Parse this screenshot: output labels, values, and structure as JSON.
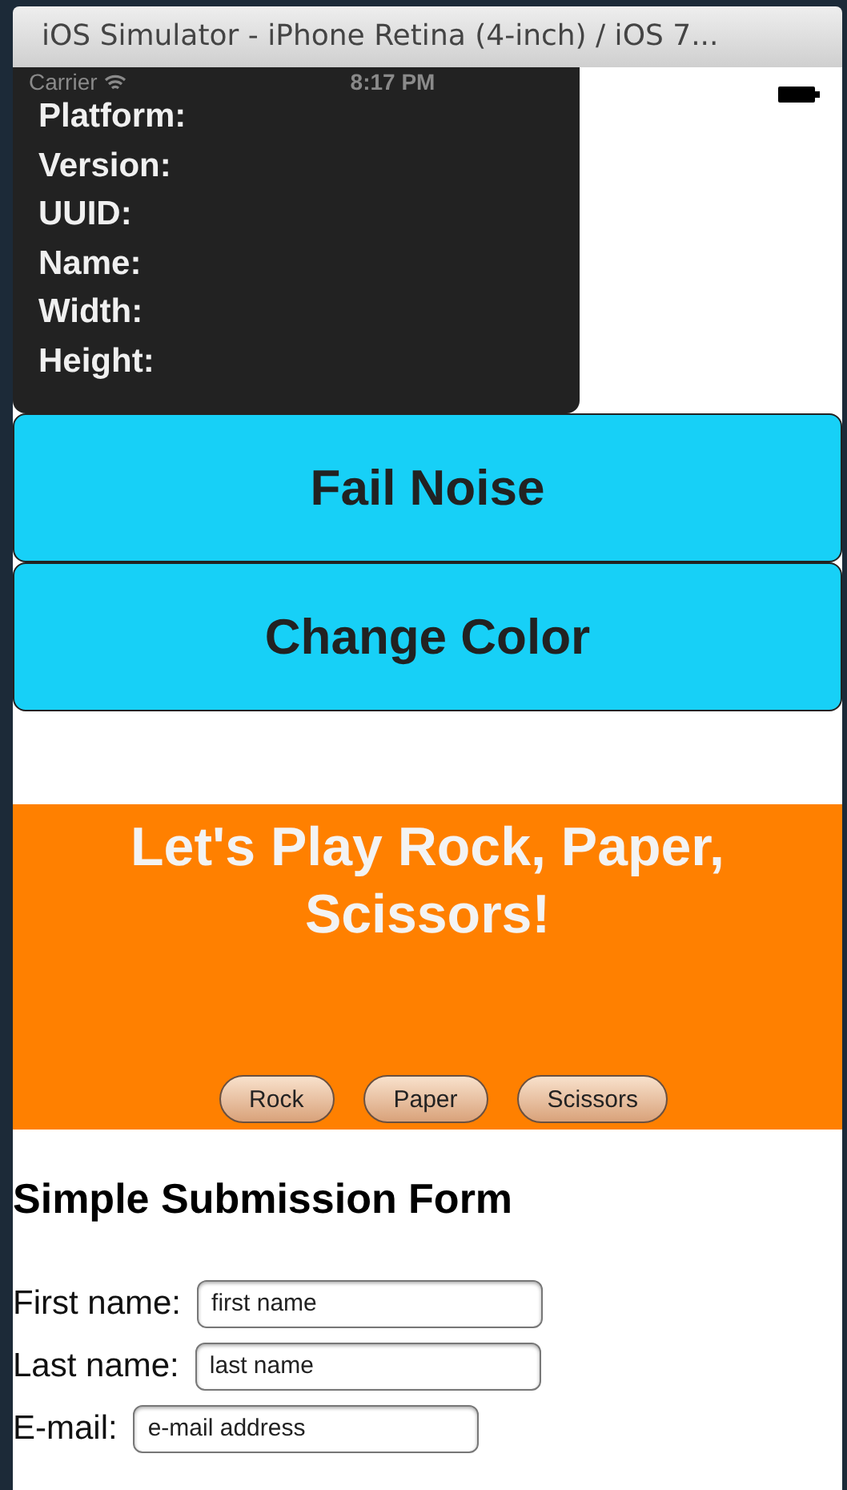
{
  "window": {
    "title": "iOS Simulator - iPhone Retina (4-inch) / iOS 7..."
  },
  "status_bar": {
    "carrier": "Carrier",
    "time": "8:17 PM"
  },
  "device_info": {
    "labels": [
      "Platform:",
      "Version:",
      "UUID:",
      "Name:",
      "Width:",
      "Height:"
    ]
  },
  "buttons": [
    "Fail Noise",
    "Change Color"
  ],
  "game": {
    "title": "Let's Play Rock, Paper, Scissors!",
    "choices": [
      "Rock",
      "Paper",
      "Scissors"
    ]
  },
  "form": {
    "title": "Simple Submission Form",
    "fields": [
      {
        "label": "First name:",
        "placeholder": "first name"
      },
      {
        "label": "Last name:",
        "placeholder": "last name"
      },
      {
        "label": "E-mail:",
        "placeholder": "e-mail address"
      }
    ]
  }
}
